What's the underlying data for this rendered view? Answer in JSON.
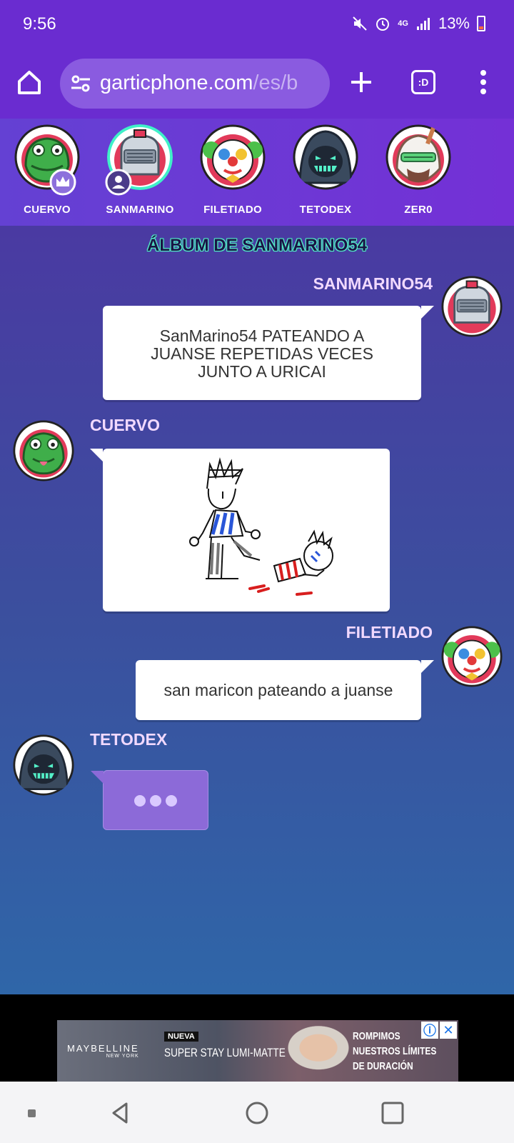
{
  "status": {
    "time": "9:56",
    "battery": "13%",
    "signal": "4G"
  },
  "browser": {
    "url_host": "garticphone.com",
    "url_path": "/es/b",
    "tab_badge": ":D"
  },
  "players": [
    {
      "name": "CUERVO"
    },
    {
      "name": "SANMARINO"
    },
    {
      "name": "FILETIADO"
    },
    {
      "name": "TETODEX"
    },
    {
      "name": "ZER0"
    }
  ],
  "album_title": "ÁLBUM DE SANMARINO54",
  "messages": [
    {
      "user": "SANMARINO54",
      "text": "SanMarino54 PATEANDO A JUANSE REPETIDAS VECES JUNTO A URICAI",
      "side": "right"
    },
    {
      "user": "CUERVO",
      "type": "drawing",
      "side": "left"
    },
    {
      "user": "FILETIADO",
      "text": "san maricon pateando a juanse",
      "side": "right"
    },
    {
      "user": "TETODEX",
      "type": "typing",
      "side": "left"
    }
  ],
  "ad": {
    "brand": "MAYBELLINE",
    "brand_sub": "NEW YORK",
    "badge": "NUEVA",
    "product": "SUPER STAY LUMI-MATTE",
    "claim_1": "ROMPIMOS",
    "claim_2": "NUESTROS LÍMITES",
    "claim_3": "DE DURACIÓN"
  },
  "colors": {
    "header": "#6a2cd0",
    "accent_teal": "#54f0c8",
    "username": "#f1d9ff"
  }
}
